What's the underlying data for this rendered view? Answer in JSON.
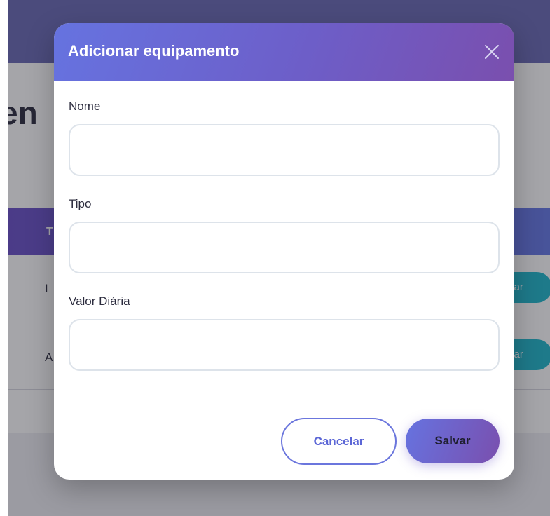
{
  "background": {
    "page_title_fragment": "en",
    "table_header_fragment": "T",
    "rows": [
      {
        "first_cell_fragment": "I",
        "action_fragment": "itar"
      },
      {
        "first_cell_fragment": "A",
        "action_fragment": "itar"
      }
    ]
  },
  "modal": {
    "title": "Adicionar equipamento",
    "fields": {
      "nome": {
        "label": "Nome",
        "value": "",
        "placeholder": ""
      },
      "tipo": {
        "label": "Tipo",
        "value": "",
        "placeholder": ""
      },
      "valor_diaria": {
        "label": "Valor Diária",
        "value": "",
        "placeholder": ""
      }
    },
    "buttons": {
      "cancel_label": "Cancelar",
      "save_label": "Salvar"
    }
  },
  "colors": {
    "header_gradient_start": "#6673e0",
    "header_gradient_end": "#7a4fae",
    "cancel_border": "#6b76dd",
    "edit_button": "#1fb8cc"
  },
  "icons": {
    "close": "close-icon"
  }
}
